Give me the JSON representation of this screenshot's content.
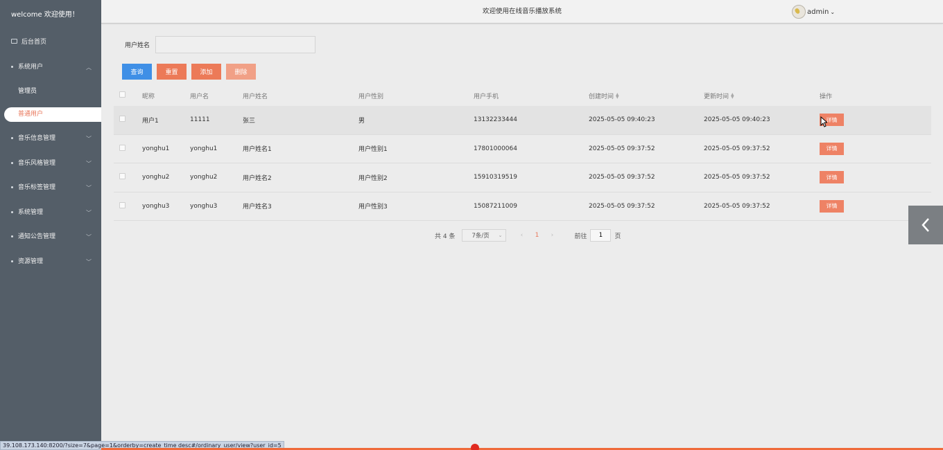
{
  "sidebar": {
    "welcome": "welcome 欢迎使用！",
    "home": "后台首页",
    "group_users": "系统用户",
    "sub_admin": "管理员",
    "sub_ordinary": "普通用户",
    "items": [
      {
        "label": "音乐信息管理"
      },
      {
        "label": "音乐风格管理"
      },
      {
        "label": "音乐标签管理"
      },
      {
        "label": "系统管理"
      },
      {
        "label": "通知公告管理"
      },
      {
        "label": "资源管理"
      }
    ]
  },
  "header": {
    "title": "欢迎使用在线音乐播放系统",
    "username": "admin"
  },
  "search": {
    "label": "用户姓名",
    "value": ""
  },
  "buttons": {
    "query": "查询",
    "reset": "重置",
    "add": "添加",
    "delete": "删除"
  },
  "table": {
    "headers": [
      "昵称",
      "用户名",
      "用户姓名",
      "用户性别",
      "用户手机",
      "创建时间",
      "更新时间",
      "操作"
    ],
    "detail_label": "详情",
    "rows": [
      [
        "用户1",
        "11111",
        "张三",
        "男",
        "13132233444",
        "2025-05-05 09:40:23",
        "2025-05-05 09:40:23"
      ],
      [
        "yonghu1",
        "yonghu1",
        "用户姓名1",
        "用户性别1",
        "17801000064",
        "2025-05-05 09:37:52",
        "2025-05-05 09:37:52"
      ],
      [
        "yonghu2",
        "yonghu2",
        "用户姓名2",
        "用户性别2",
        "15910319519",
        "2025-05-05 09:37:52",
        "2025-05-05 09:37:52"
      ],
      [
        "yonghu3",
        "yonghu3",
        "用户姓名3",
        "用户性别3",
        "15087211009",
        "2025-05-05 09:37:52",
        "2025-05-05 09:37:52"
      ]
    ]
  },
  "pagination": {
    "total": "共 4 条",
    "page_size": "7条/页",
    "current": "1",
    "goto_label": "前往",
    "goto_value": "1",
    "page_suffix": "页"
  },
  "status_url": "39.108.173.140:8200/?size=7&page=1&orderby=create_time desc#/ordinary_user/view?user_id=5",
  "colors": {
    "sidebar_bg": "#545e68",
    "accent": "#e8765a",
    "query_btn": "#3f8fe6"
  }
}
